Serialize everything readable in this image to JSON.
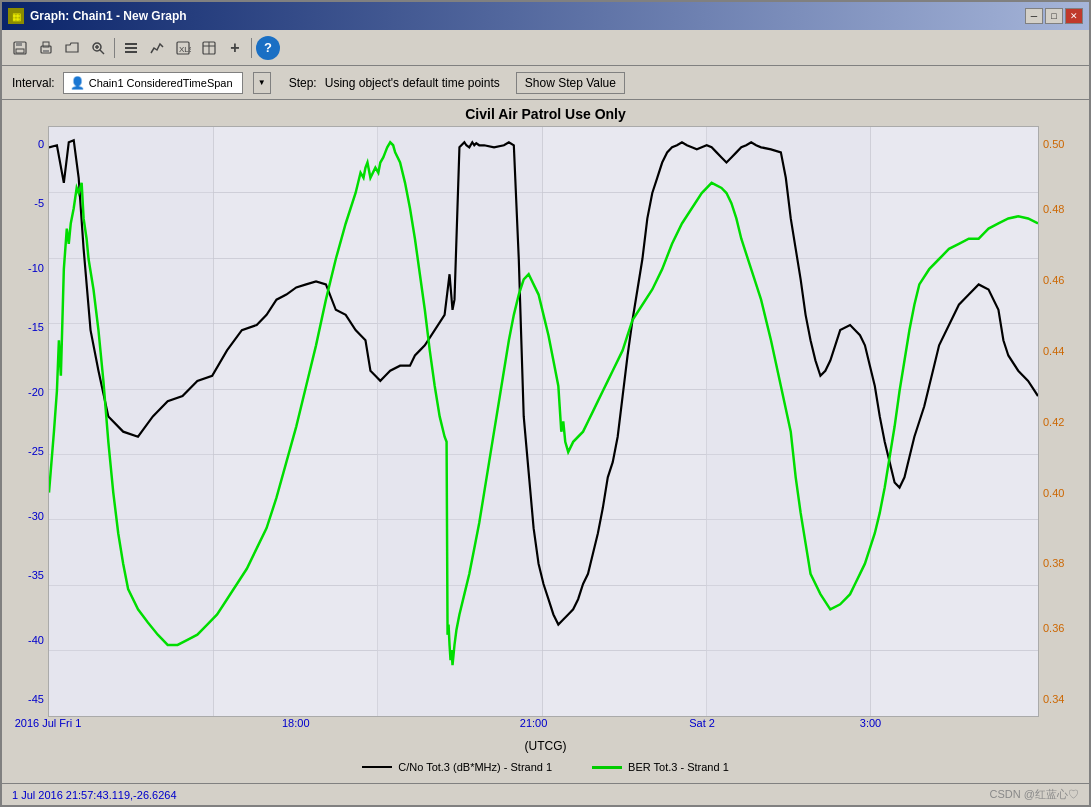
{
  "window": {
    "title": "Graph:  Chain1 - New Graph",
    "icon": "graph-icon"
  },
  "title_buttons": {
    "minimize": "─",
    "maximize": "□",
    "close": "✕"
  },
  "toolbar": {
    "buttons": [
      {
        "name": "save",
        "icon": "💾"
      },
      {
        "name": "print",
        "icon": "🖨"
      },
      {
        "name": "open",
        "icon": "📂"
      },
      {
        "name": "zoom-in",
        "icon": "🔍"
      },
      {
        "name": "settings1",
        "icon": "⊞"
      },
      {
        "name": "settings2",
        "icon": "⊟"
      },
      {
        "name": "export",
        "icon": "📊"
      },
      {
        "name": "chart-type",
        "icon": "📈"
      },
      {
        "name": "add",
        "icon": "+"
      },
      {
        "name": "help",
        "icon": "?"
      }
    ]
  },
  "interval": {
    "label": "Interval:",
    "value": "Chain1 ConsideredTimeSpan",
    "icon": "👤",
    "step_label": "Step:",
    "step_value": "Using object's default time points",
    "show_step_button": "Show Step Value"
  },
  "chart": {
    "title": "Civil Air Patrol Use Only",
    "y_left_label": "",
    "y_right_label": "",
    "y_left_ticks": [
      "0",
      "-5",
      "-10",
      "-15",
      "-20",
      "-25",
      "-30",
      "-35",
      "-40",
      "-45"
    ],
    "y_right_ticks": [
      "0.50",
      "0.48",
      "0.46",
      "0.44",
      "0.42",
      "0.40",
      "0.38",
      "0.36",
      "0.34"
    ],
    "x_ticks": [
      "2016 Jul Fri 1",
      "18:00",
      "21:00",
      "Sat 2",
      "3:00"
    ],
    "x_label": "(UTCG)",
    "legend": [
      {
        "label": "C/No Tot.3 (dB*MHz) - Strand 1",
        "color": "black"
      },
      {
        "label": "BER Tot.3 - Strand 1",
        "color": "green"
      }
    ]
  },
  "status": {
    "left": "1 Jul 2016 21:57:43.119,-26.6264",
    "right": "CSDN @红蓝心♡"
  }
}
